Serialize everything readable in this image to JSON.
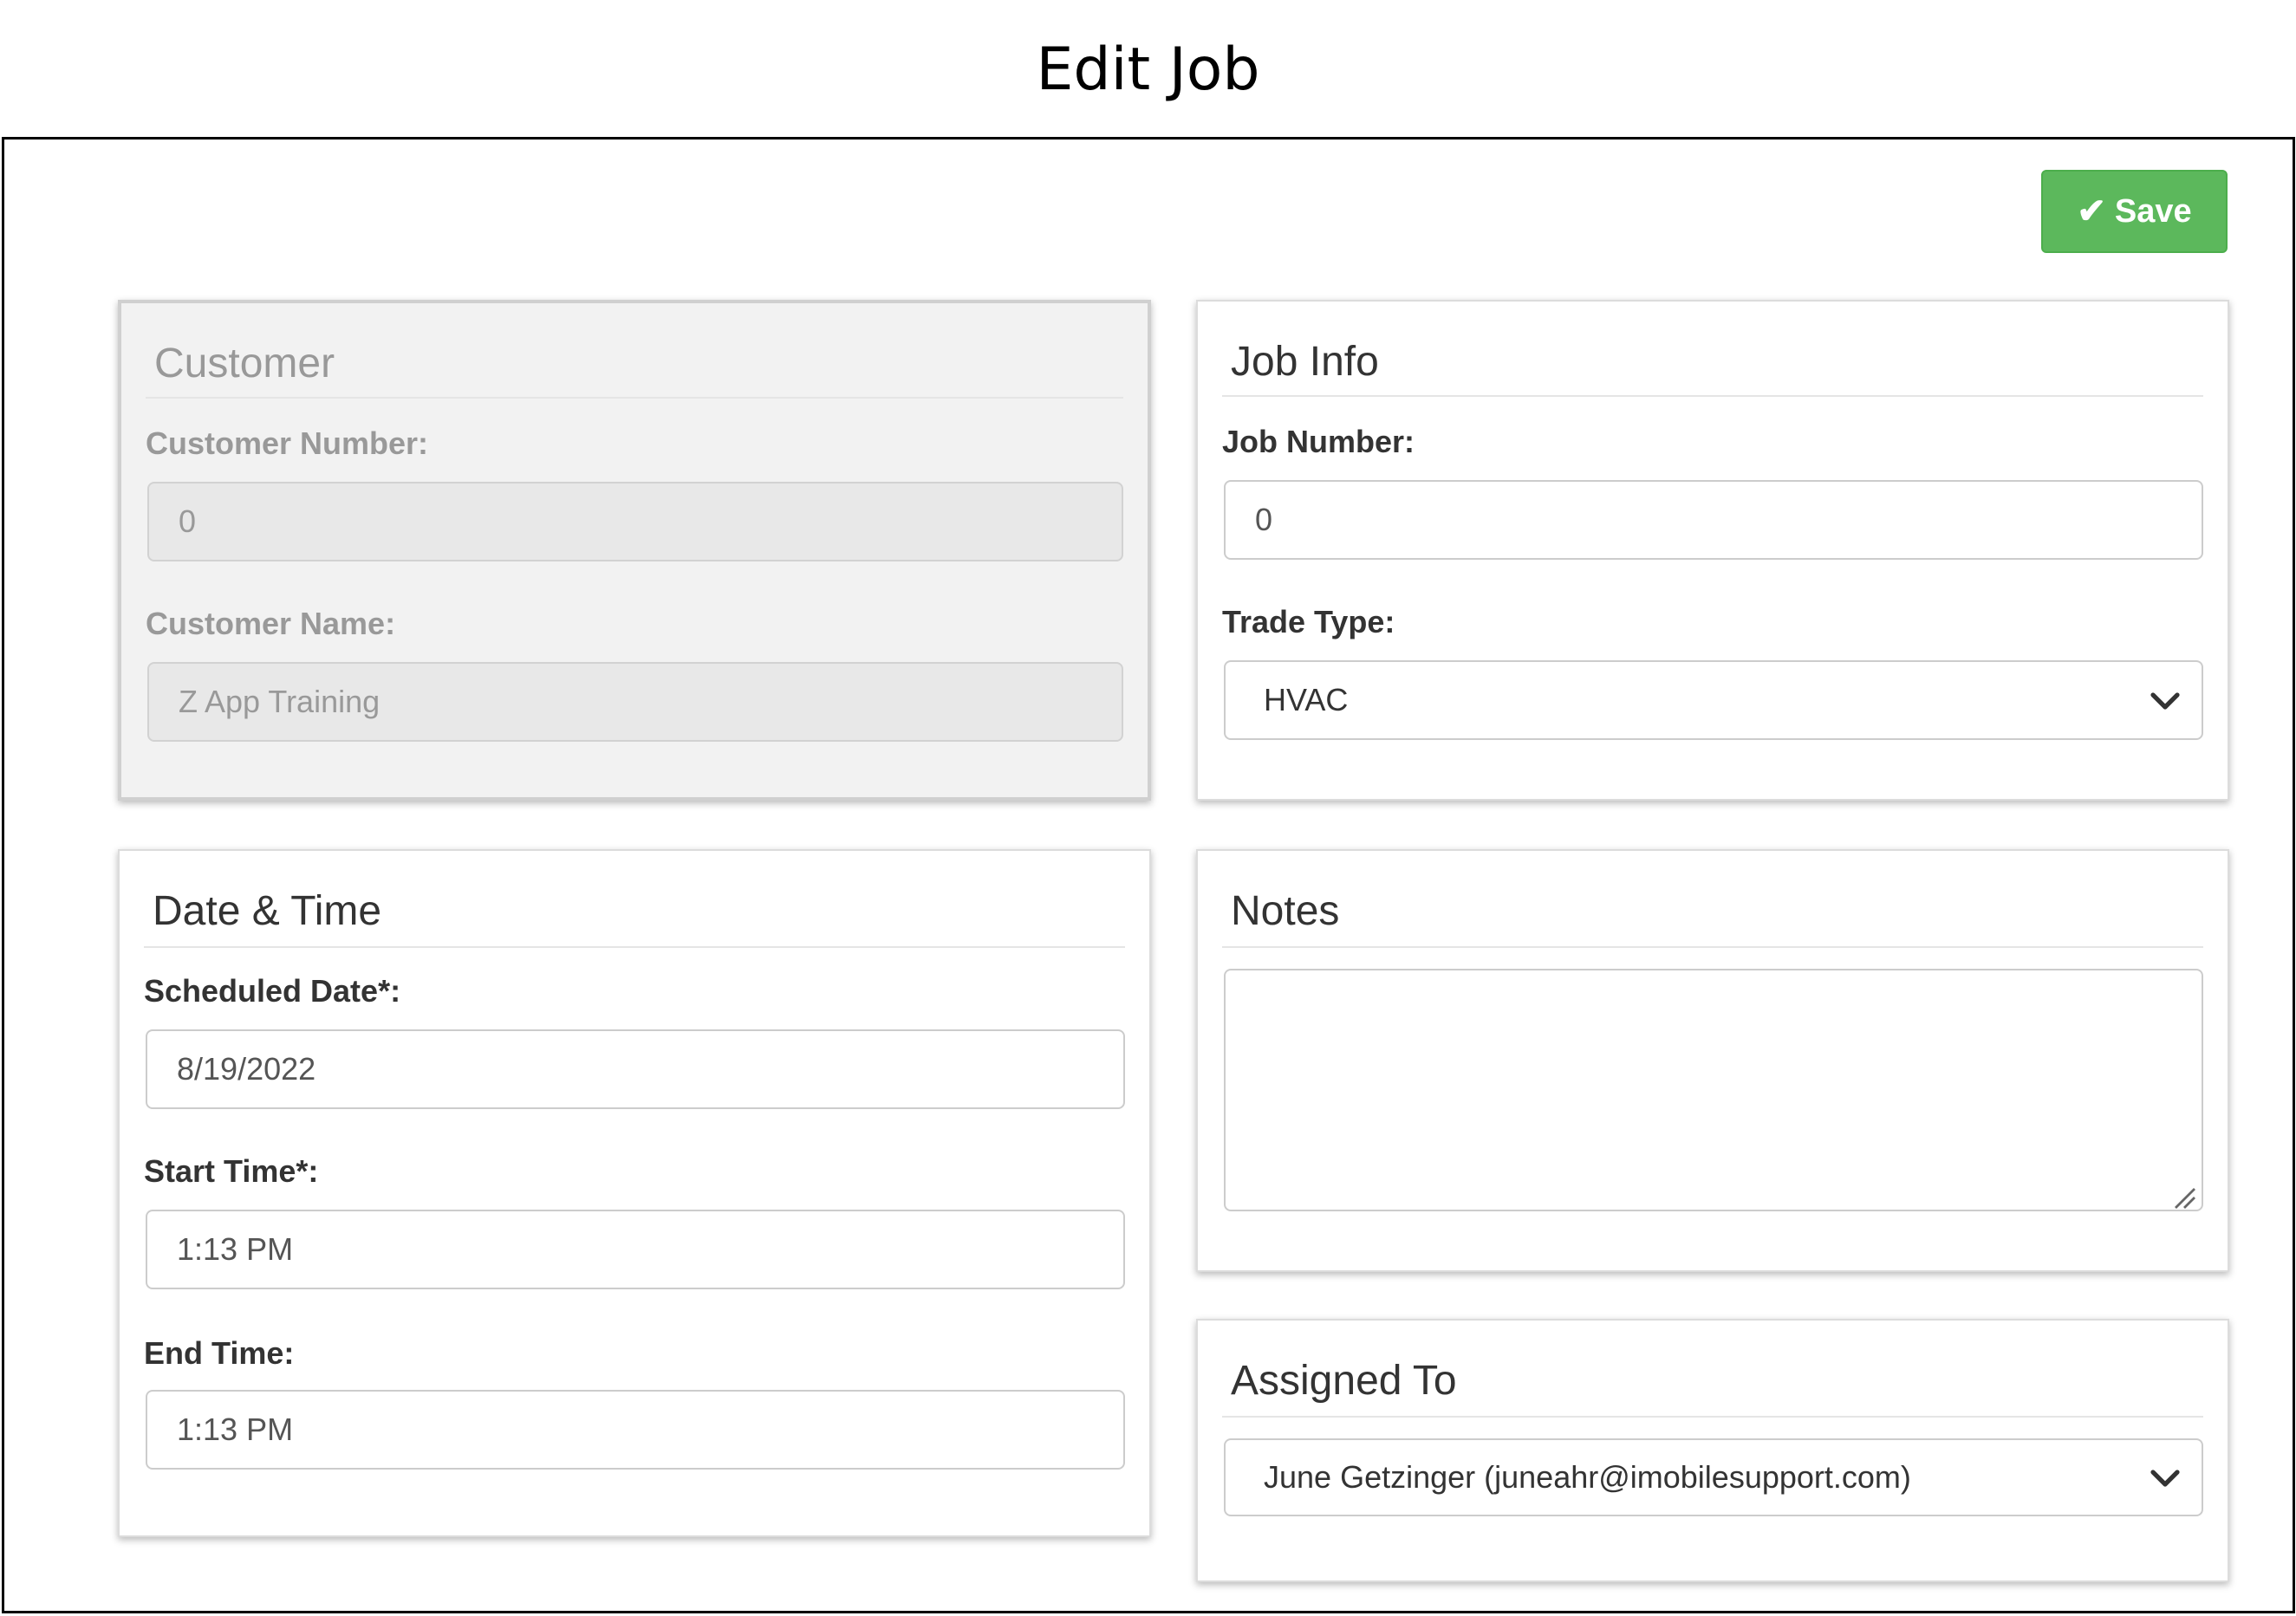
{
  "page": {
    "title": "Edit Job"
  },
  "toolbar": {
    "save_label": "Save",
    "save_icon": "check-icon"
  },
  "customer": {
    "title": "Customer",
    "number_label": "Customer Number:",
    "number_value": "0",
    "name_label": "Customer Name:",
    "name_value": "Z App Training"
  },
  "job_info": {
    "title": "Job Info",
    "number_label": "Job Number:",
    "number_value": "0",
    "trade_label": "Trade Type:",
    "trade_value": "HVAC"
  },
  "date_time": {
    "title": "Date & Time",
    "date_label": "Scheduled Date*:",
    "date_value": "8/19/2022",
    "start_label": "Start Time*:",
    "start_value": "1:13 PM",
    "end_label": "End Time:",
    "end_value": "1:13 PM"
  },
  "notes": {
    "title": "Notes",
    "value": ""
  },
  "assigned": {
    "title": "Assigned To",
    "value": "June Getzinger (juneahr@imobilesupport.com)"
  },
  "colors": {
    "save_button": "#5cb85c",
    "disabled_panel": "#f2f2f2",
    "text": "#333333"
  }
}
